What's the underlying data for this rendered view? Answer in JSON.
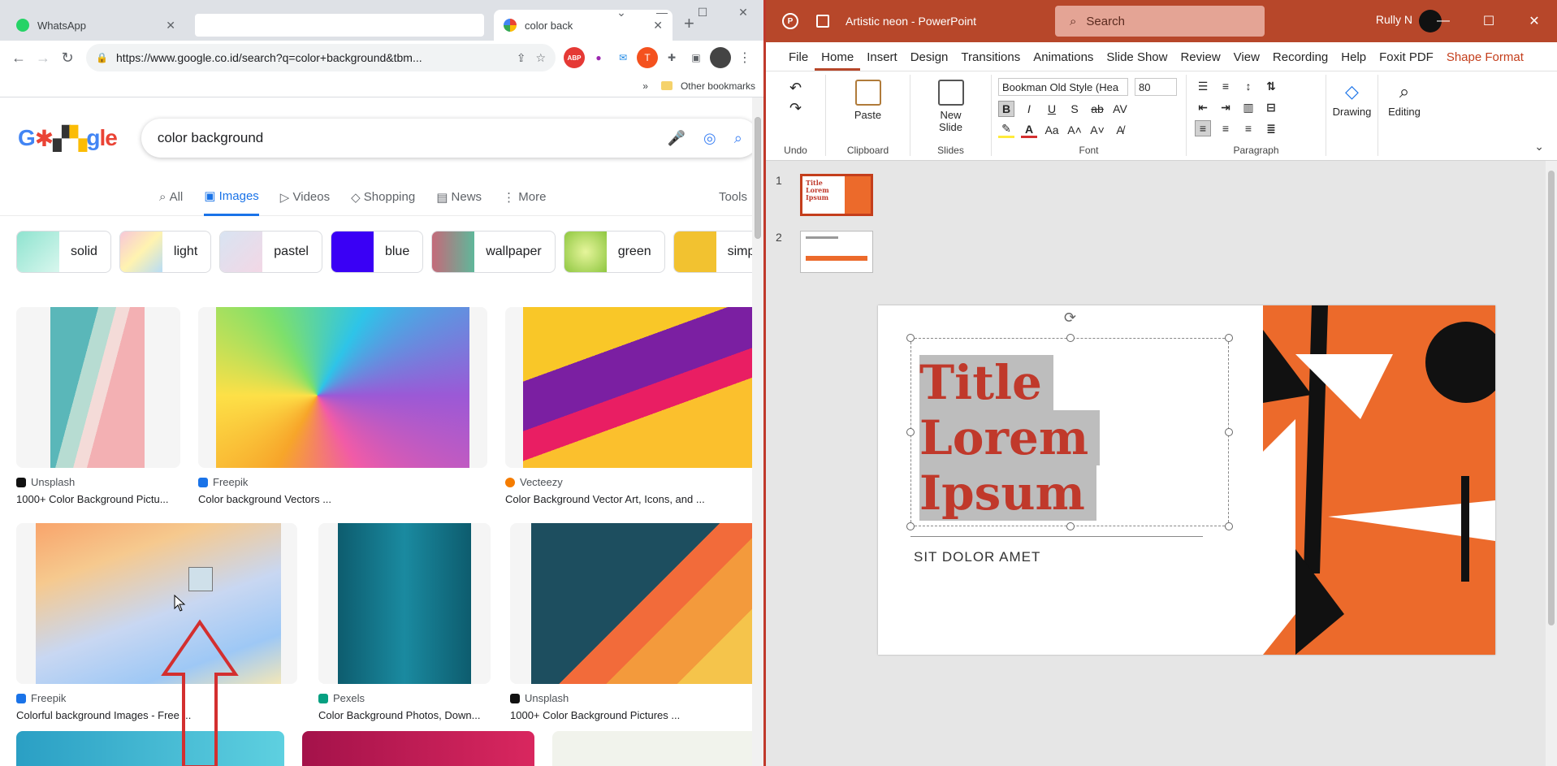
{
  "chrome": {
    "tabs": [
      {
        "title": "WhatsApp",
        "icon": "whatsapp-icon",
        "color": "#25d366"
      },
      {
        "title": "",
        "icon": "",
        "color": ""
      },
      {
        "title": "color back",
        "icon": "google-icon",
        "color": "#4285f4"
      }
    ],
    "url": "https://www.google.co.id/search?q=color+background&tbm...",
    "bookmarks_more": "»",
    "bookmark_folder": "Other bookmarks",
    "search_query": "color background",
    "search_tabs": [
      "All",
      "Images",
      "Videos",
      "Shopping",
      "News",
      "More"
    ],
    "tools": "Tools",
    "chips": [
      {
        "label": "solid",
        "color": "#8ee3cf"
      },
      {
        "label": "light",
        "color": "#f7c6d9"
      },
      {
        "label": "pastel",
        "color": "#d8e4f2"
      },
      {
        "label": "blue",
        "color": "#3a00f5"
      },
      {
        "label": "wallpaper",
        "color": "#c46a7a"
      },
      {
        "label": "green",
        "color": "#8dc63f"
      },
      {
        "label": "simple",
        "color": "#f2c230"
      }
    ],
    "results": [
      {
        "source": "Unsplash",
        "title": "1000+ Color Background Pictu..."
      },
      {
        "source": "Freepik",
        "title": "Color background Vectors ..."
      },
      {
        "source": "Vecteezy",
        "title": "Color Background Vector Art, Icons, and ..."
      },
      {
        "source": "Freepik",
        "title": "Colorful background Images - Free ..."
      },
      {
        "source": "Pexels",
        "title": "Color Background Photos, Down..."
      },
      {
        "source": "Unsplash",
        "title": "1000+ Color Background Pictures ..."
      }
    ]
  },
  "ppt": {
    "doc_name": "Artistic neon  -  PowerPoint",
    "search_placeholder": "Search",
    "user": "Rully N",
    "menus": [
      "File",
      "Home",
      "Insert",
      "Design",
      "Transitions",
      "Animations",
      "Slide Show",
      "Review",
      "View",
      "Recording",
      "Help",
      "Foxit PDF",
      "Shape Format"
    ],
    "groups": {
      "undo": "Undo",
      "clipboard": "Clipboard",
      "paste": "Paste",
      "slides": "Slides",
      "new_slide": "New Slide",
      "font": "Font",
      "paragraph": "Paragraph",
      "drawing": "Drawing",
      "editing": "Editing"
    },
    "font_name": "Bookman Old Style (Hea",
    "font_size": "80",
    "slide_numbers": [
      "1",
      "2"
    ],
    "slide_title_lines": [
      "Title",
      "Lorem",
      "Ipsum"
    ],
    "slide_subtitle": "SIT DOLOR AMET",
    "accent": "#b7472a",
    "title_color": "#c0392b",
    "art_color": "#ec6a2b"
  }
}
